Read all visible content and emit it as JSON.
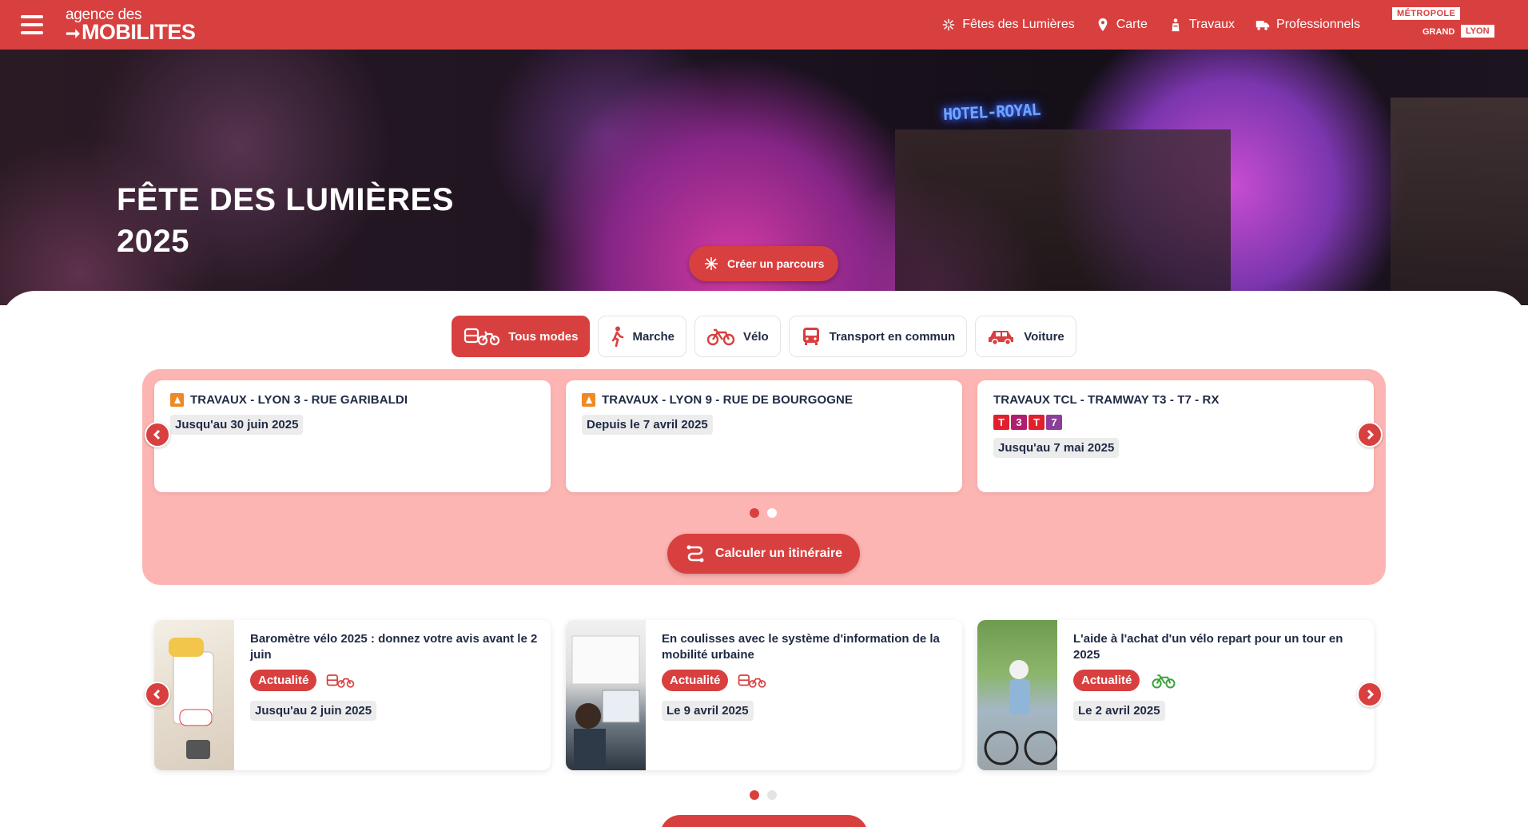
{
  "header": {
    "logo_line1": "agence des",
    "logo_line2": "MOBILITES",
    "nav": [
      {
        "label": "Fêtes des Lumières",
        "icon": "firework-icon"
      },
      {
        "label": "Carte",
        "icon": "map-pin-icon"
      },
      {
        "label": "Travaux",
        "icon": "worker-icon"
      },
      {
        "label": "Professionnels",
        "icon": "truck-icon"
      }
    ],
    "metropole": {
      "line1": "MÉTROPOLE",
      "line2": "GRAND",
      "line3": "LYON"
    }
  },
  "hero": {
    "title_line1": "FÊTE DES LUMIÈRES",
    "title_line2": "2025",
    "sign": "HOTEL-ROYAL",
    "cta_label": "Créer un parcours"
  },
  "modes": [
    {
      "label": "Tous modes",
      "icon": "all-modes-icon",
      "active": true
    },
    {
      "label": "Marche",
      "icon": "walk-icon",
      "active": false
    },
    {
      "label": "Vélo",
      "icon": "bike-icon",
      "active": false
    },
    {
      "label": "Transport en commun",
      "icon": "bus-icon",
      "active": false
    },
    {
      "label": "Voiture",
      "icon": "car-icon",
      "active": false
    }
  ],
  "travaux": {
    "cards": [
      {
        "title": "TRAVAUX - LYON 3 - RUE GARIBALDI",
        "date": "Jusqu'au 30 juin 2025",
        "icon": "roadwork-icon"
      },
      {
        "title": "TRAVAUX - LYON 9 - RUE DE BOURGOGNE",
        "date": "Depuis le 7 avril 2025",
        "icon": "roadwork-icon"
      },
      {
        "title": "TRAVAUX TCL - TRAMWAY T3 - T7 - RX",
        "date": "Jusqu'au 7 mai 2025",
        "lines": [
          {
            "text": "T",
            "color": "#e2202c"
          },
          {
            "text": "3",
            "color": "#b01f6d"
          },
          {
            "text": "T",
            "color": "#e2202c"
          },
          {
            "text": "7",
            "color": "#8a3f98"
          }
        ]
      }
    ],
    "dots": 2,
    "active_dot": 0,
    "calc_label": "Calculer un itinéraire"
  },
  "news": {
    "cards": [
      {
        "title": "Baromètre vélo 2025 : donnez votre avis avant le 2 juin",
        "badge": "Actualité",
        "mode_icon": "all-modes-icon",
        "date": "Jusqu'au 2 juin 2025"
      },
      {
        "title": "En coulisses avec le système d'information de la mobilité urbaine",
        "badge": "Actualité",
        "mode_icon": "all-modes-icon",
        "date": "Le 9 avril 2025"
      },
      {
        "title": "L'aide à l'achat d'un vélo repart pour un tour en 2025",
        "badge": "Actualité",
        "mode_icon": "bike-icon",
        "date": "Le 2 avril 2025"
      }
    ],
    "dots": 2,
    "active_dot": 0
  },
  "colors": {
    "brand": "#d8403f",
    "pink_bg": "#fdb5b3",
    "text": "#1f2a44",
    "bike_green": "#3aa33a"
  }
}
